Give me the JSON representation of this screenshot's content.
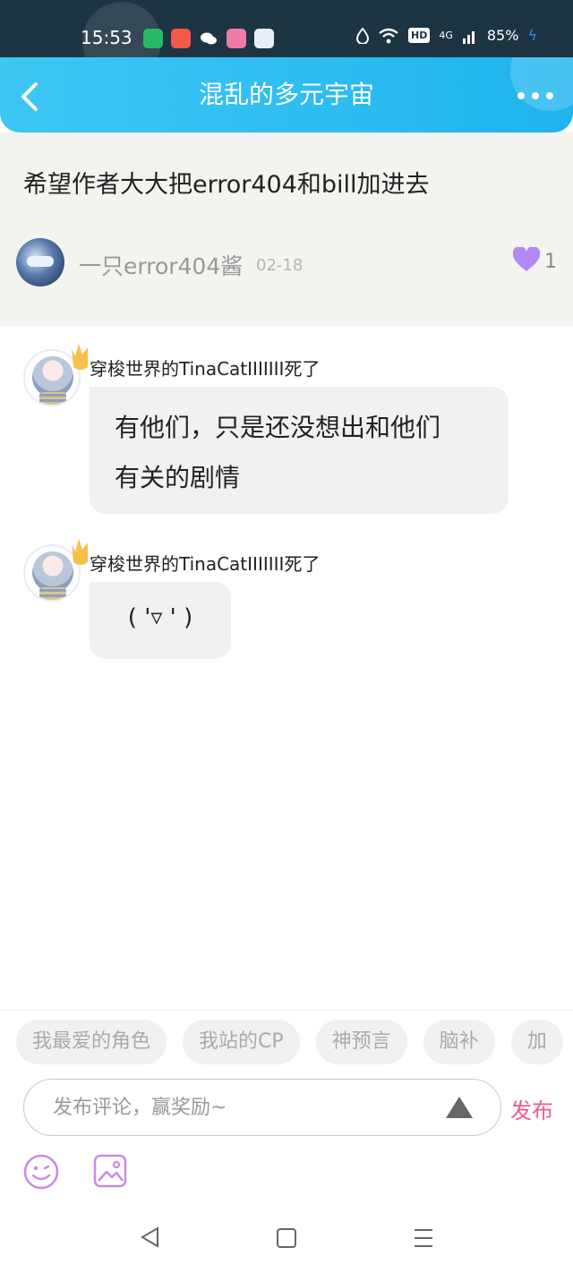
{
  "status_bar": {
    "time": "15:53",
    "network": "4G",
    "battery": "85%",
    "hd": "HD"
  },
  "header": {
    "title": "混乱的多元宇宙"
  },
  "post": {
    "text": "希望作者大大把error404和bill加进去",
    "author": "一只error404酱",
    "date": "02-18",
    "likes": "1"
  },
  "comments": [
    {
      "user": "穿梭世界的TinaCatIIIIIII死了",
      "text_line1": "有他们，只是还没想出和他们",
      "text_line2": "有关的剧情"
    },
    {
      "user": "穿梭世界的TinaCatIIIIIII死了",
      "text": "( '▿ ' )"
    }
  ],
  "tags": [
    "我最爱的角色",
    "我站的CP",
    "神预言",
    "脑补",
    "加"
  ],
  "composer": {
    "placeholder": "发布评论，赢奖励~",
    "publish_label": "发布"
  },
  "colors": {
    "header": "#2bbdf2",
    "accent": "#ee5c8c",
    "like": "#b388f5"
  }
}
